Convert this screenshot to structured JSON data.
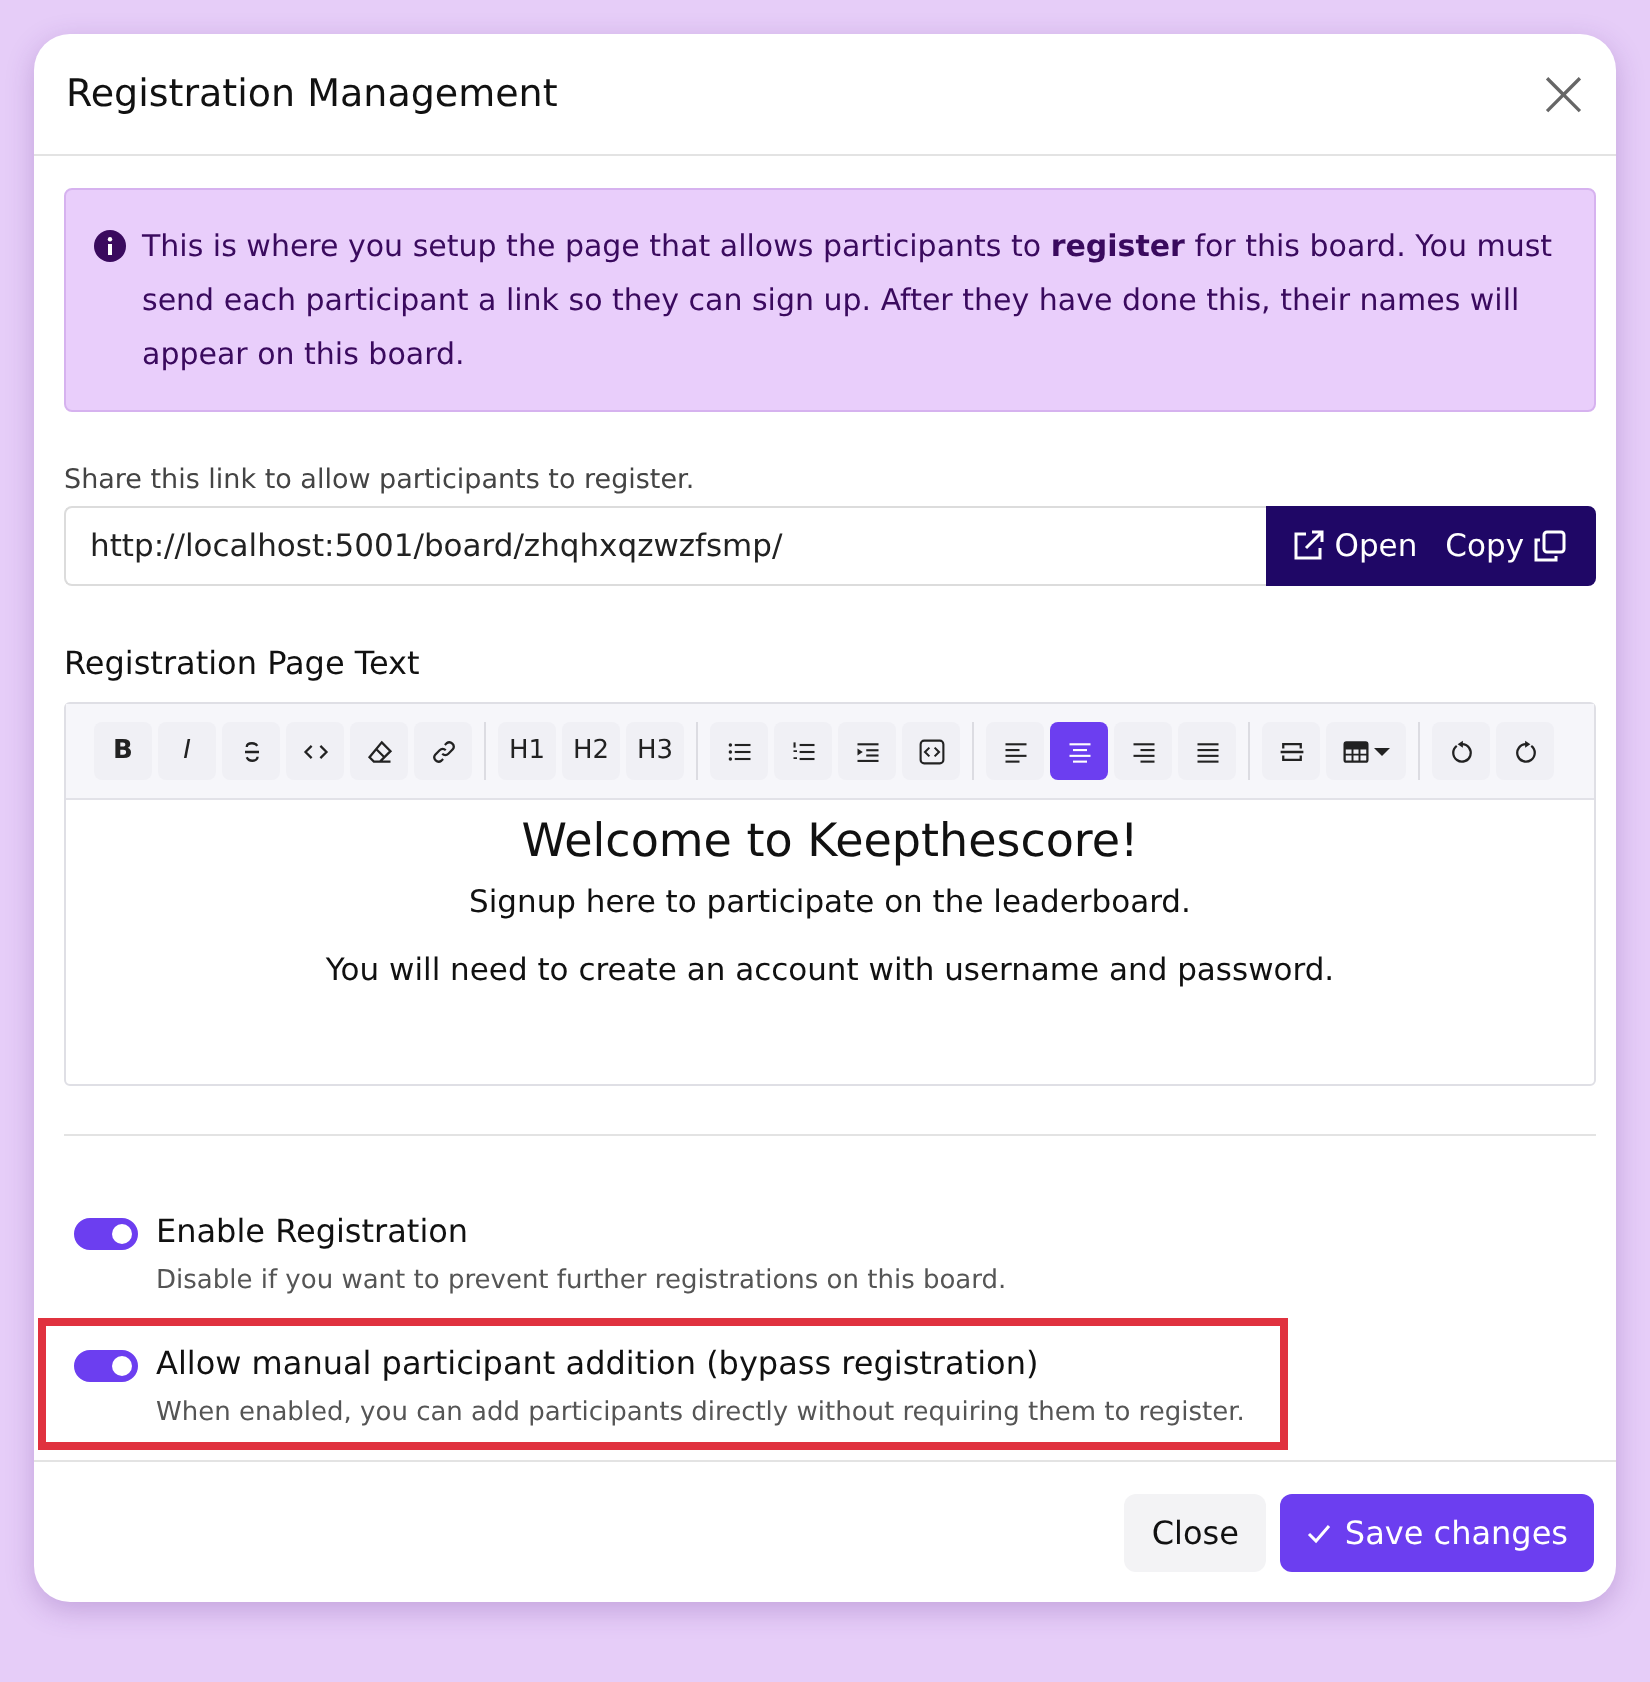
{
  "dialog": {
    "title": "Registration Management",
    "close_icon": "×"
  },
  "alert": {
    "text": "This is where you setup the page that allows participants to **register** for this board. You must send each participant a link so they can sign up. After they have done this, their names will appear on this board."
  },
  "share": {
    "label": "Share this link to allow participants to register.",
    "value": "http://localhost:5001/board/zhqhxqzwzfsmp/",
    "buttons": [
      {
        "kind": "open",
        "label": "Open"
      },
      {
        "kind": "copy",
        "label": "Copy"
      }
    ]
  },
  "editor": {
    "label": "Registration Page Text",
    "toolbar": [
      [
        {
          "kind": "text",
          "label": "B",
          "selected": false
        },
        {
          "kind": "text",
          "label": "I",
          "selected": false
        },
        {
          "kind": "icon",
          "selected": false
        },
        {
          "kind": "icon",
          "selected": false
        },
        {
          "kind": "icon",
          "selected": false
        },
        {
          "kind": "icon",
          "selected": false
        }
      ],
      [
        {
          "kind": "text",
          "label": "H1",
          "selected": false
        },
        {
          "kind": "text",
          "label": "H2",
          "selected": false
        },
        {
          "kind": "text",
          "label": "H3",
          "selected": false
        }
      ],
      [
        {
          "kind": "icon",
          "selected": false
        },
        {
          "kind": "icon",
          "selected": false
        },
        {
          "kind": "icon",
          "selected": false
        },
        {
          "kind": "icon",
          "selected": false
        }
      ],
      [
        {
          "kind": "icon",
          "selected": false
        },
        {
          "kind": "icon",
          "selected": true
        },
        {
          "kind": "icon",
          "selected": false
        },
        {
          "kind": "icon",
          "selected": false
        }
      ],
      [
        {
          "kind": "icon",
          "selected": false
        },
        {
          "kind": "icon",
          "selected": false
        }
      ],
      [
        {
          "kind": "icon",
          "selected": false
        },
        {
          "kind": "icon",
          "selected": false
        }
      ]
    ],
    "content": [
      {
        "kind": "heading",
        "text": "Welcome to Keepthescore!"
      },
      {
        "kind": "paragraph",
        "text": "Signup here to participate on the leaderboard."
      },
      {
        "kind": "paragraph",
        "text": "You will need to create an account with username and password."
      }
    ]
  },
  "settings": [
    {
      "label": "Enable Registration",
      "description": "Disable if you want to prevent further registrations on this board.",
      "on": true,
      "highlighted": false
    },
    {
      "label": "Allow manual participant addition (bypass registration)",
      "description": "When enabled, you can add participants directly without requiring them to register.",
      "on": true,
      "highlighted": true
    }
  ],
  "footer": {
    "buttons": [
      {
        "kind": "secondary",
        "label": "Close"
      },
      {
        "kind": "primary",
        "label": "Save changes"
      }
    ]
  }
}
